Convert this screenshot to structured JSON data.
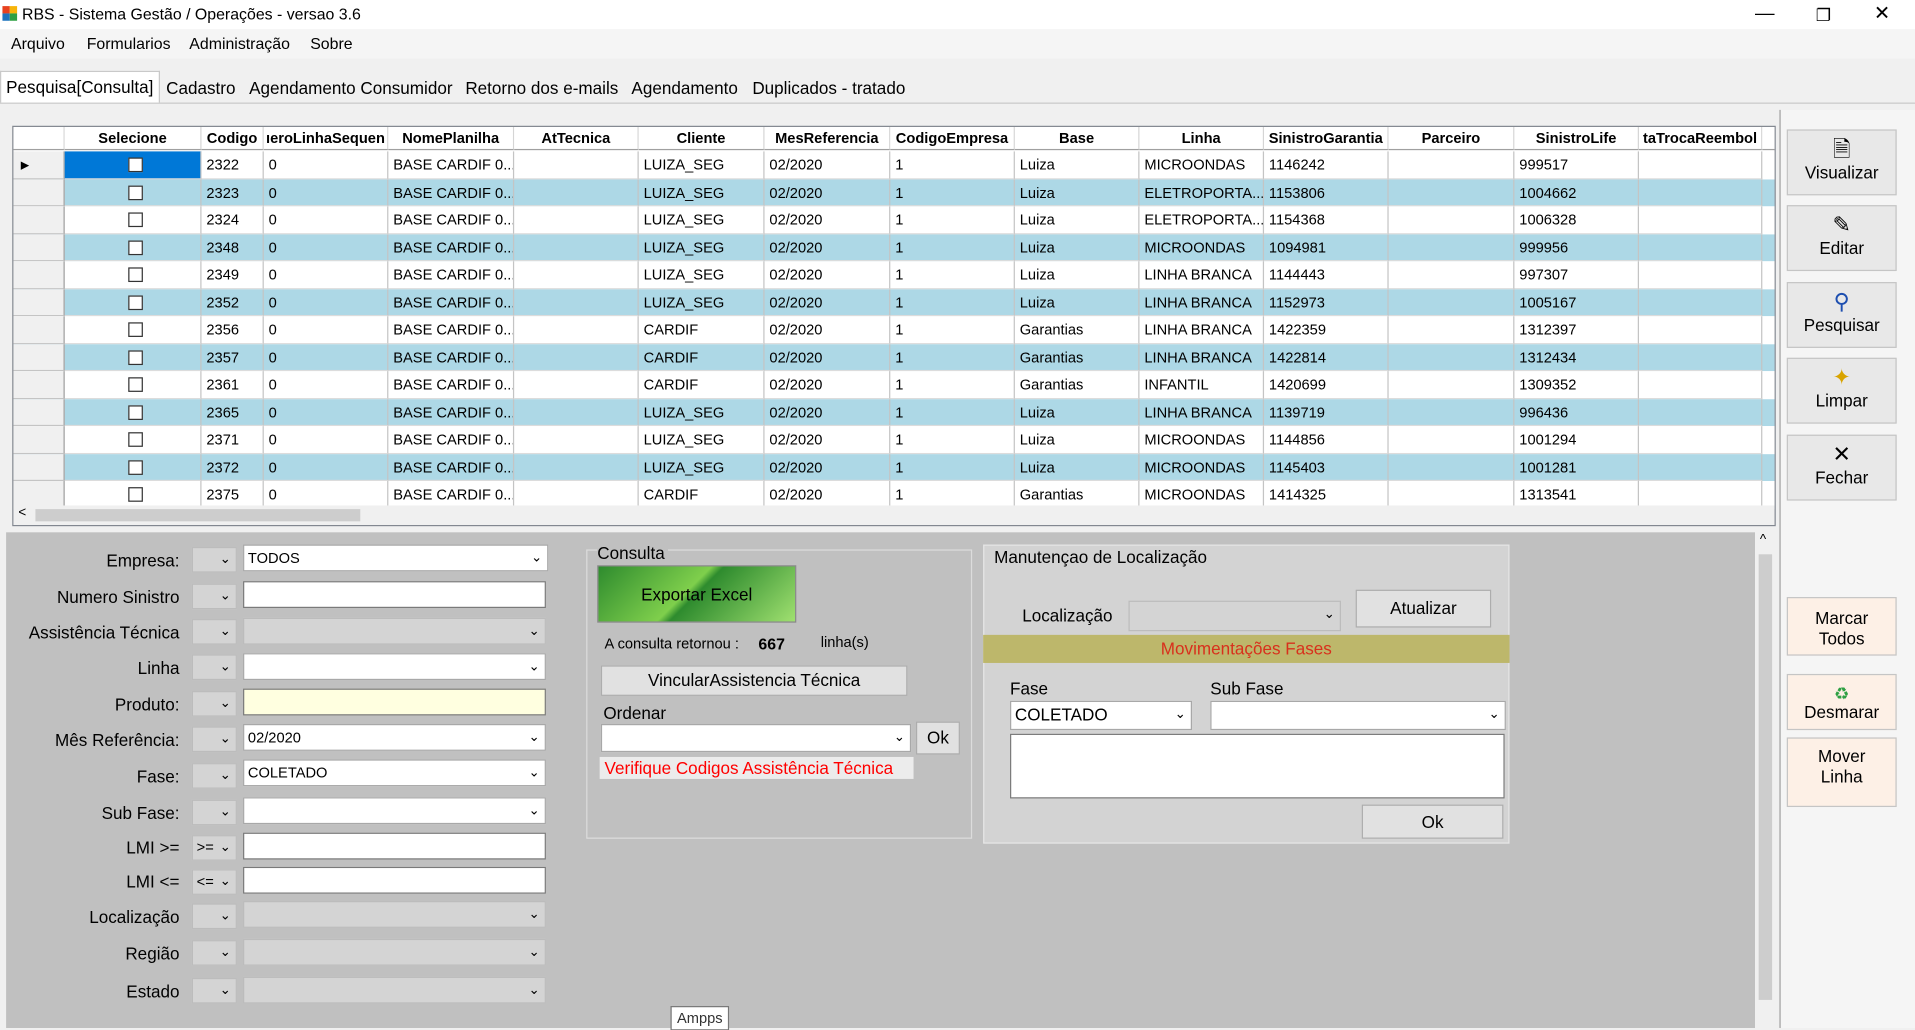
{
  "window": {
    "title": "RBS - Sistema Gestão / Operações - versao 3.6",
    "minimize": "—",
    "restore": "❐",
    "close": "✕"
  },
  "menu": [
    "Arquivo",
    "Formularios",
    "Administração",
    "Sobre"
  ],
  "tabs": [
    "Pesquisa[Consulta]",
    "Cadastro",
    "Agendamento Consumidor",
    "Retorno dos e-mails",
    "Agendamento",
    "Duplicados - tratado"
  ],
  "grid": {
    "columns": [
      "Selecione",
      "Codigo",
      "ıeroLinhaSequen",
      "NomePlanilha",
      "AtTecnica",
      "Cliente",
      "MesReferencia",
      "CodigoEmpresa",
      "Base",
      "Linha",
      "SinistroGarantia",
      "Parceiro",
      "SinistroLife",
      "taTrocaReembol"
    ],
    "current_row_marker": "▶",
    "rows": [
      [
        "2322",
        "0",
        "BASE CARDIF 0...",
        "",
        "LUIZA_SEG",
        "02/2020",
        "1",
        "Luiza",
        "MICROONDAS",
        "1146242",
        "",
        "999517",
        ""
      ],
      [
        "2323",
        "0",
        "BASE CARDIF 0...",
        "",
        "LUIZA_SEG",
        "02/2020",
        "1",
        "Luiza",
        "ELETROPORTA...",
        "1153806",
        "",
        "1004662",
        ""
      ],
      [
        "2324",
        "0",
        "BASE CARDIF 0...",
        "",
        "LUIZA_SEG",
        "02/2020",
        "1",
        "Luiza",
        "ELETROPORTA...",
        "1154368",
        "",
        "1006328",
        ""
      ],
      [
        "2348",
        "0",
        "BASE CARDIF 0...",
        "",
        "LUIZA_SEG",
        "02/2020",
        "1",
        "Luiza",
        "MICROONDAS",
        "1094981",
        "",
        "999956",
        ""
      ],
      [
        "2349",
        "0",
        "BASE CARDIF 0...",
        "",
        "LUIZA_SEG",
        "02/2020",
        "1",
        "Luiza",
        "LINHA BRANCA",
        "1144443",
        "",
        "997307",
        ""
      ],
      [
        "2352",
        "0",
        "BASE CARDIF 0...",
        "",
        "LUIZA_SEG",
        "02/2020",
        "1",
        "Luiza",
        "LINHA BRANCA",
        "1152973",
        "",
        "1005167",
        ""
      ],
      [
        "2356",
        "0",
        "BASE CARDIF 0...",
        "",
        "CARDIF",
        "02/2020",
        "1",
        "Garantias",
        "LINHA BRANCA",
        "1422359",
        "",
        "1312397",
        ""
      ],
      [
        "2357",
        "0",
        "BASE CARDIF 0...",
        "",
        "CARDIF",
        "02/2020",
        "1",
        "Garantias",
        "LINHA BRANCA",
        "1422814",
        "",
        "1312434",
        ""
      ],
      [
        "2361",
        "0",
        "BASE CARDIF 0...",
        "",
        "CARDIF",
        "02/2020",
        "1",
        "Garantias",
        "INFANTIL",
        "1420699",
        "",
        "1309352",
        ""
      ],
      [
        "2365",
        "0",
        "BASE CARDIF 0...",
        "",
        "LUIZA_SEG",
        "02/2020",
        "1",
        "Luiza",
        "LINHA BRANCA",
        "1139719",
        "",
        "996436",
        ""
      ],
      [
        "2371",
        "0",
        "BASE CARDIF 0...",
        "",
        "LUIZA_SEG",
        "02/2020",
        "1",
        "Luiza",
        "MICROONDAS",
        "1144856",
        "",
        "1001294",
        ""
      ],
      [
        "2372",
        "0",
        "BASE CARDIF 0...",
        "",
        "LUIZA_SEG",
        "02/2020",
        "1",
        "Luiza",
        "MICROONDAS",
        "1145403",
        "",
        "1001281",
        ""
      ],
      [
        "2375",
        "0",
        "BASE CARDIF 0...",
        "",
        "CARDIF",
        "02/2020",
        "1",
        "Garantias",
        "MICROONDAS",
        "1414325",
        "",
        "1313541",
        ""
      ]
    ],
    "row_colors": {
      "even": "#add8e6",
      "odd": "#ffffff"
    }
  },
  "toolbar": {
    "visualizar": "Visualizar",
    "editar": "Editar",
    "pesquisar": "Pesquisar",
    "limpar": "Limpar",
    "fechar": "Fechar",
    "marcar_todos_1": "Marcar",
    "marcar_todos_2": "Todos",
    "desmarcar": "Desmarar",
    "mover_linha_1": "Mover",
    "mover_linha_2": "Linha"
  },
  "filters": {
    "empresa": {
      "label": "Empresa:",
      "value": "TODOS"
    },
    "numero_sinistro": {
      "label": "Numero Sinistro",
      "value": ""
    },
    "assistencia_tecnica": {
      "label": "Assistência Técnica",
      "value": ""
    },
    "linha": {
      "label": "Linha",
      "value": ""
    },
    "produto": {
      "label": "Produto:",
      "value": ""
    },
    "mes_referencia": {
      "label": "Mês Referência:",
      "value": "02/2020"
    },
    "fase": {
      "label": "Fase:",
      "value": "COLETADO"
    },
    "sub_fase": {
      "label": "Sub Fase:",
      "value": ""
    },
    "lmi_min": {
      "label": "LMI >=",
      "operator": ">=",
      "value": ""
    },
    "lmi_max": {
      "label": "LMI <=",
      "operator": "<=",
      "value": ""
    },
    "localizacao": {
      "label": "Localização",
      "value": ""
    },
    "regiao": {
      "label": "Região",
      "value": ""
    },
    "estado": {
      "label": "Estado",
      "value": ""
    }
  },
  "consulta": {
    "title": "Consulta",
    "exportar": "Exportar Excel",
    "retorno_label": "A consulta retornou :",
    "retorno_count": "667",
    "retorno_unit": "linha(s)",
    "vincular": "VincularAssistencia Técnica",
    "ordenar_label": "Ordenar",
    "ordenar_value": "",
    "ok": "Ok",
    "warning": "Verifique Codigos Assistência Técnica"
  },
  "localizacao": {
    "title": "Manutençao de Localização",
    "label": "Localização",
    "value": "",
    "atualizar": "Atualizar",
    "movimentacoes": "Movimentações Fases",
    "fase_label": "Fase",
    "fase_value": "COLETADO",
    "subfase_label": "Sub Fase",
    "subfase_value": "",
    "ok": "Ok"
  },
  "tooltip": "Ampps",
  "accent": {
    "selection": "#0078d7",
    "warning": "#ff0000",
    "band": "#bdb76b"
  }
}
